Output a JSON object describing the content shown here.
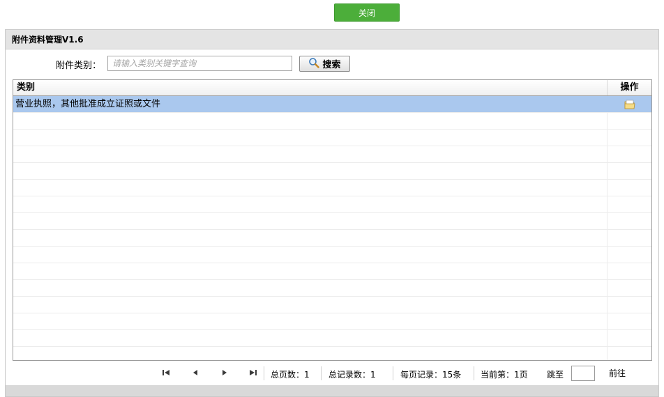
{
  "top": {
    "close_label": "关闭"
  },
  "panel": {
    "title": "附件资料管理V1.6"
  },
  "search": {
    "label": "附件类别：",
    "placeholder": "请输入类别关键字查询",
    "button_label": "搜索"
  },
  "grid": {
    "headers": {
      "category": "类别",
      "actions": "操作"
    },
    "rows": [
      {
        "category": "营业执照，其他批准成立证照或文件",
        "selected": true
      }
    ]
  },
  "pager": {
    "total_pages": "总页数：1",
    "total_records": "总记录数：1",
    "per_page": "每页记录：15条",
    "current": "当前第：1页",
    "jump_label": "跳至",
    "go_label": "前往"
  },
  "colors": {
    "close_button": "#4cae3a",
    "selected_row": "#aac8ee",
    "title_bar": "#e4e4e4"
  },
  "icons": {
    "search": "magnifier-icon",
    "row_action": "folder-edit-icon"
  }
}
